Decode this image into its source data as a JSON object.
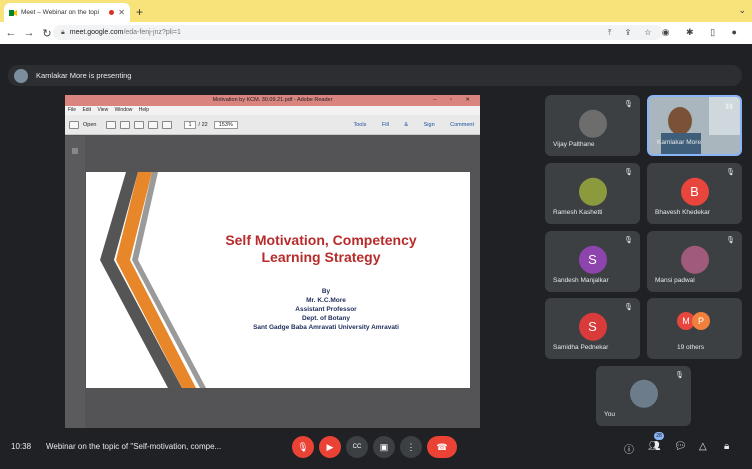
{
  "browser": {
    "tab_title": "Meet – Webinar on the topi",
    "tab_close": "✕",
    "new_tab": "+",
    "tab_dropdown": "⌄",
    "nav_back": "←",
    "nav_forward": "→",
    "nav_reload": "↻",
    "url_host": "meet.google.com",
    "url_path": "/eda-fenj-jnz?pli=1",
    "omni_icons": "⤒ ⇪ ☆",
    "toolbar_icons": "◉ ✱ ▯ ●"
  },
  "presenting_banner": "Kamlakar More is presenting",
  "reader": {
    "title": "Motivation by KCM. 30.09.21.pdf - Adobe Reader",
    "window_controls": "– ▫ ✕",
    "menu": "File Edit View Window Help",
    "open_label": "Open",
    "page_current": "1",
    "page_total": "/ 22",
    "zoom": "153%",
    "tools_links": "Tools Fill & Sign Comment"
  },
  "slide": {
    "title_line1": "Self Motivation, Competency",
    "title_line2": "Learning Strategy",
    "by": "By",
    "author": "Mr. K.C.More",
    "role": "Assistant Professor",
    "dept": "Dept. of Botany",
    "university": "Sant Gadge Baba Amravati University Amravati"
  },
  "participants": [
    {
      "name": "Vijay Palthane",
      "initial": "",
      "color": "#6d6d6d"
    },
    {
      "name": "Kamlakar More",
      "initial": "",
      "color": "#6d6d6d"
    },
    {
      "name": "Ramesh Kashetti",
      "initial": "",
      "color": "#8a9a3c"
    },
    {
      "name": "Bhavesh Khedekar",
      "initial": "B",
      "color": "#e8453c"
    },
    {
      "name": "Sandesh Manjalkar",
      "initial": "S",
      "color": "#8e44ad"
    },
    {
      "name": "Mansi padwal",
      "initial": "",
      "color": "#a05a7a"
    },
    {
      "name": "Samidha Pednekar",
      "initial": "S",
      "color": "#d93a3a"
    },
    {
      "name": "19 others",
      "initial": "",
      "color": "#e8453c"
    },
    {
      "name": "You",
      "initial": "",
      "color": "#6d7c8a"
    }
  ],
  "others_initials": [
    "M",
    "P"
  ],
  "bottom": {
    "time": "10:38",
    "meeting_title": "Webinar on the topic of \"Self-motivation, compe...",
    "people_count": "28"
  },
  "colors": {
    "accent_blue": "#8ab4f8",
    "alert_red": "#ea4335",
    "tab_bar": "#f8e27a",
    "slide_title": "#b72b2b"
  }
}
